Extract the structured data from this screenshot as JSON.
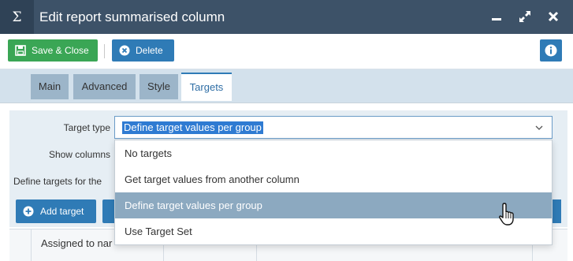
{
  "window": {
    "icon": "sigma-icon",
    "title": "Edit report summarised column",
    "controls": [
      "minimize-icon",
      "expand-icon",
      "close-icon"
    ],
    "titlebar_color": "#3d5268"
  },
  "toolbar": {
    "save_label": "Save & Close",
    "delete_label": "Delete",
    "save_color": "#3aa655",
    "primary_color": "#2f7bb6"
  },
  "tabs": [
    {
      "label": "Main"
    },
    {
      "label": "Advanced"
    },
    {
      "label": "Style"
    },
    {
      "label": "Targets",
      "active": true
    }
  ],
  "form": {
    "target_type_label": "Target type",
    "target_type_value": "Define target values per group",
    "show_columns_label": "Show columns",
    "define_targets_label": "Define targets for the",
    "options": [
      {
        "label": "No targets"
      },
      {
        "label": "Get target values from another column"
      },
      {
        "label": "Define target values per group",
        "highlighted": true
      },
      {
        "label": "Use Target Set"
      }
    ]
  },
  "actions": {
    "add_target_label": "Add target"
  },
  "grid": {
    "columns": [
      "Assigned to nar"
    ]
  }
}
